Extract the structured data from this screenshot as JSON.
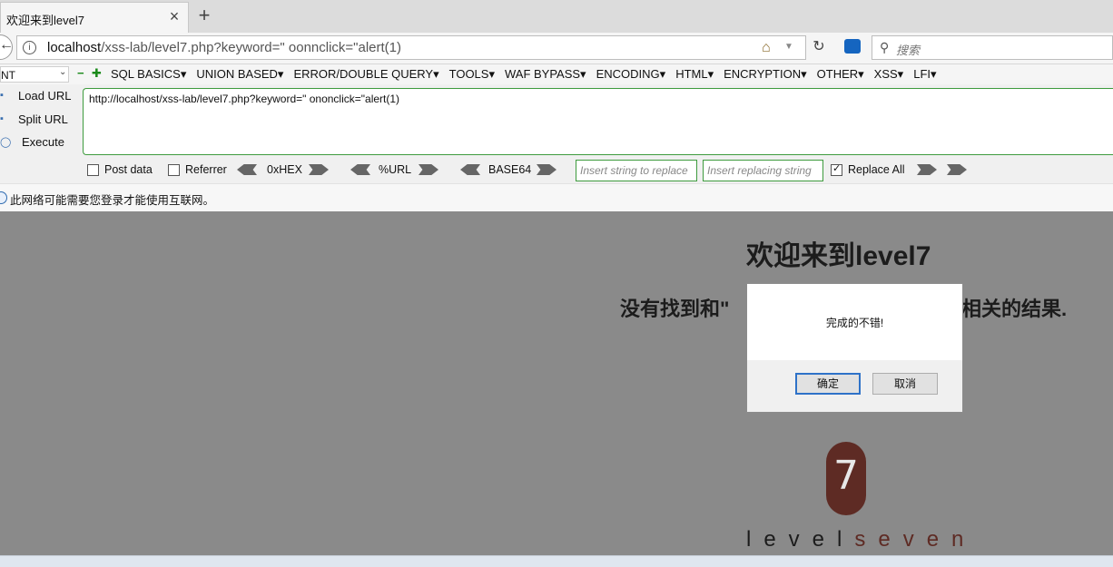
{
  "tab": {
    "title": "欢迎来到level7"
  },
  "nav": {
    "url_host": "localhost",
    "url_rest": "/xss-lab/level7.php?keyword=\" oonnclick=\"alert(1)",
    "search_placeholder": "搜索"
  },
  "hackbar": {
    "select_value": "NT",
    "menus": [
      "SQL BASICS▾",
      "UNION BASED▾",
      "ERROR/DOUBLE QUERY▾",
      "TOOLS▾",
      "WAF BYPASS▾",
      "ENCODING▾",
      "HTML▾",
      "ENCRYPTION▾",
      "OTHER▾",
      "XSS▾",
      "LFI▾"
    ],
    "side": {
      "load": "Load URL",
      "split": "Split URL",
      "execute": "Execute"
    },
    "url_text": "http://localhost/xss-lab/level7.php?keyword=\" ononclick=\"alert(1)",
    "post_data": "Post data",
    "referrer": "Referrer",
    "hex": "0xHEX",
    "url_enc": "%URL",
    "base64": "BASE64",
    "insert_string": "Insert string to replace",
    "insert_replacing": "Insert replacing string",
    "replace_all": "Replace All"
  },
  "notice": {
    "text": "此网络可能需要您登录才能使用互联网。"
  },
  "page": {
    "heading": "欢迎来到level7",
    "result_left": "没有找到和\"",
    "result_right": "相关的结果.",
    "logo_num": "7",
    "logo_a": "level",
    "logo_b": "seven"
  },
  "dialog": {
    "message": "完成的不错!",
    "ok": "确定",
    "cancel": "取消"
  }
}
